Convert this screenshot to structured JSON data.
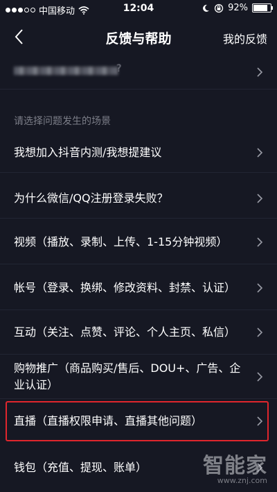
{
  "status_bar": {
    "carrier": "中国移动",
    "time": "12:04",
    "battery_percent": "92%",
    "signal_level": 0.6,
    "battery_level": 0.92,
    "icons": [
      "signal-dots-icon",
      "wifi-icon",
      "moon-icon",
      "rotation-lock-icon",
      "battery-icon"
    ]
  },
  "nav": {
    "back_icon": "chevron-left-icon",
    "title": "反馈与帮助",
    "right_action": "我的反馈"
  },
  "blurred_row": {
    "visible_tail": "    ?"
  },
  "section": {
    "label": "请选择问题发生的场景"
  },
  "items": [
    {
      "label": "我想加入抖音内测/我想提建议"
    },
    {
      "label": "为什么微信/QQ注册登录失败？"
    },
    {
      "label": "视频（播放、录制、上传、1-15分钟视频）"
    },
    {
      "label": "帐号（登录、换绑、修改资料、封禁、认证）"
    },
    {
      "label": "互动（关注、点赞、评论、个人主页、私信）"
    },
    {
      "label": "购物推广（商品购买/售后、DOU+、广告、企业认证）"
    },
    {
      "label": "直播（直播权限申请、直播其他问题）"
    },
    {
      "label": "钱包（充值、提现、账单）"
    }
  ],
  "watermark": {
    "brand": "智能家",
    "url": "www.znj.com"
  },
  "colors": {
    "background": "#161823",
    "highlight": "#e0262d",
    "secondary_text": "#7c7e88"
  }
}
